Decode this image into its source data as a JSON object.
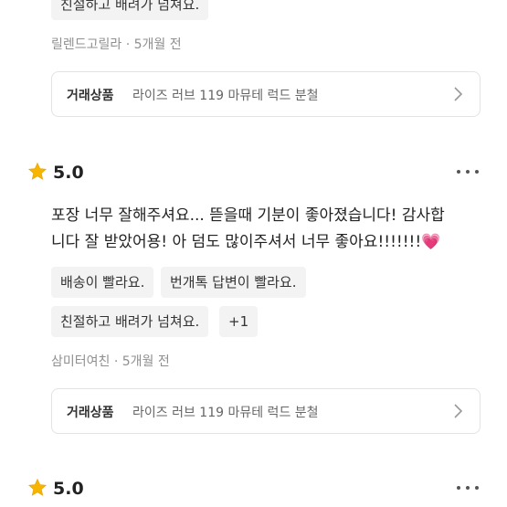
{
  "review_prev": {
    "chip": "친절하고 배려가 넘쳐요.",
    "author": "릴렌드고릴라",
    "time": "5개월 전",
    "product_label": "거래상품",
    "product_name": "라이즈 러브 119 마뮤테 럭드 분철"
  },
  "review_main": {
    "score": "5.0",
    "text_line1": "포장 너무 잘해주셔요... 뜯을때 기분이 좋아졌습니다! 감사합",
    "text_line2": "니다 잘 받았어용! 아 덤도 많이주셔서 너무 좋아요!!!!!!!",
    "text_emoji": "💗",
    "chips": [
      "배송이 빨라요.",
      "번개톡 답변이 빨라요.",
      "친절하고 배려가 넘쳐요.",
      "+1"
    ],
    "author": "삼미터여친",
    "time": "5개월 전",
    "product_label": "거래상품",
    "product_name": "라이즈 러브 119 마뮤테 럭드 분철"
  },
  "review_next": {
    "score": "5.0"
  },
  "icons": {
    "star": "star-icon",
    "more": "more-dots-icon",
    "chevron": "chevron-right-icon"
  },
  "colors": {
    "star": "#F7B500",
    "chip_bg": "#F3F3F3",
    "meta_text": "#8F8F8F",
    "heart": "#E8458B"
  }
}
